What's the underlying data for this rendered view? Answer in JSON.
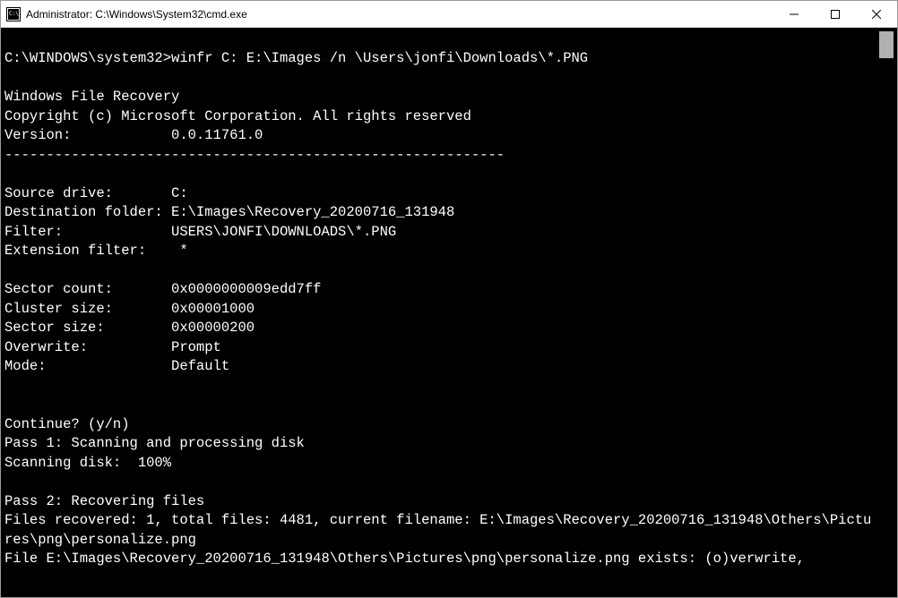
{
  "titlebar": {
    "title": "Administrator: C:\\Windows\\System32\\cmd.exe"
  },
  "terminal": {
    "prompt": "C:\\WINDOWS\\system32>",
    "command": "winfr C: E:\\Images /n \\Users\\jonfi\\Downloads\\*.PNG",
    "blank": "",
    "header1": "Windows File Recovery",
    "header2": "Copyright (c) Microsoft Corporation. All rights reserved",
    "version": "Version:            0.0.11761.0",
    "separator": "------------------------------------------------------------",
    "source_drive": "Source drive:       C:",
    "dest_folder": "Destination folder: E:\\Images\\Recovery_20200716_131948",
    "filter": "Filter:             USERS\\JONFI\\DOWNLOADS\\*.PNG",
    "ext_filter": "Extension filter:    *",
    "sector_count": "Sector count:       0x0000000009edd7ff",
    "cluster_size": "Cluster size:       0x00001000",
    "sector_size": "Sector size:        0x00000200",
    "overwrite": "Overwrite:          Prompt",
    "mode": "Mode:               Default",
    "continue_prompt": "Continue? (y/n)",
    "pass1": "Pass 1: Scanning and processing disk",
    "scanning": "Scanning disk:  100%",
    "pass2": "Pass 2: Recovering files",
    "files_recovered": "Files recovered: 1, total files: 4481, current filename: E:\\Images\\Recovery_20200716_131948\\Others\\Pictures\\png\\personalize.png",
    "file_exists": "File E:\\Images\\Recovery_20200716_131948\\Others\\Pictures\\png\\personalize.png exists: (o)verwrite,"
  }
}
